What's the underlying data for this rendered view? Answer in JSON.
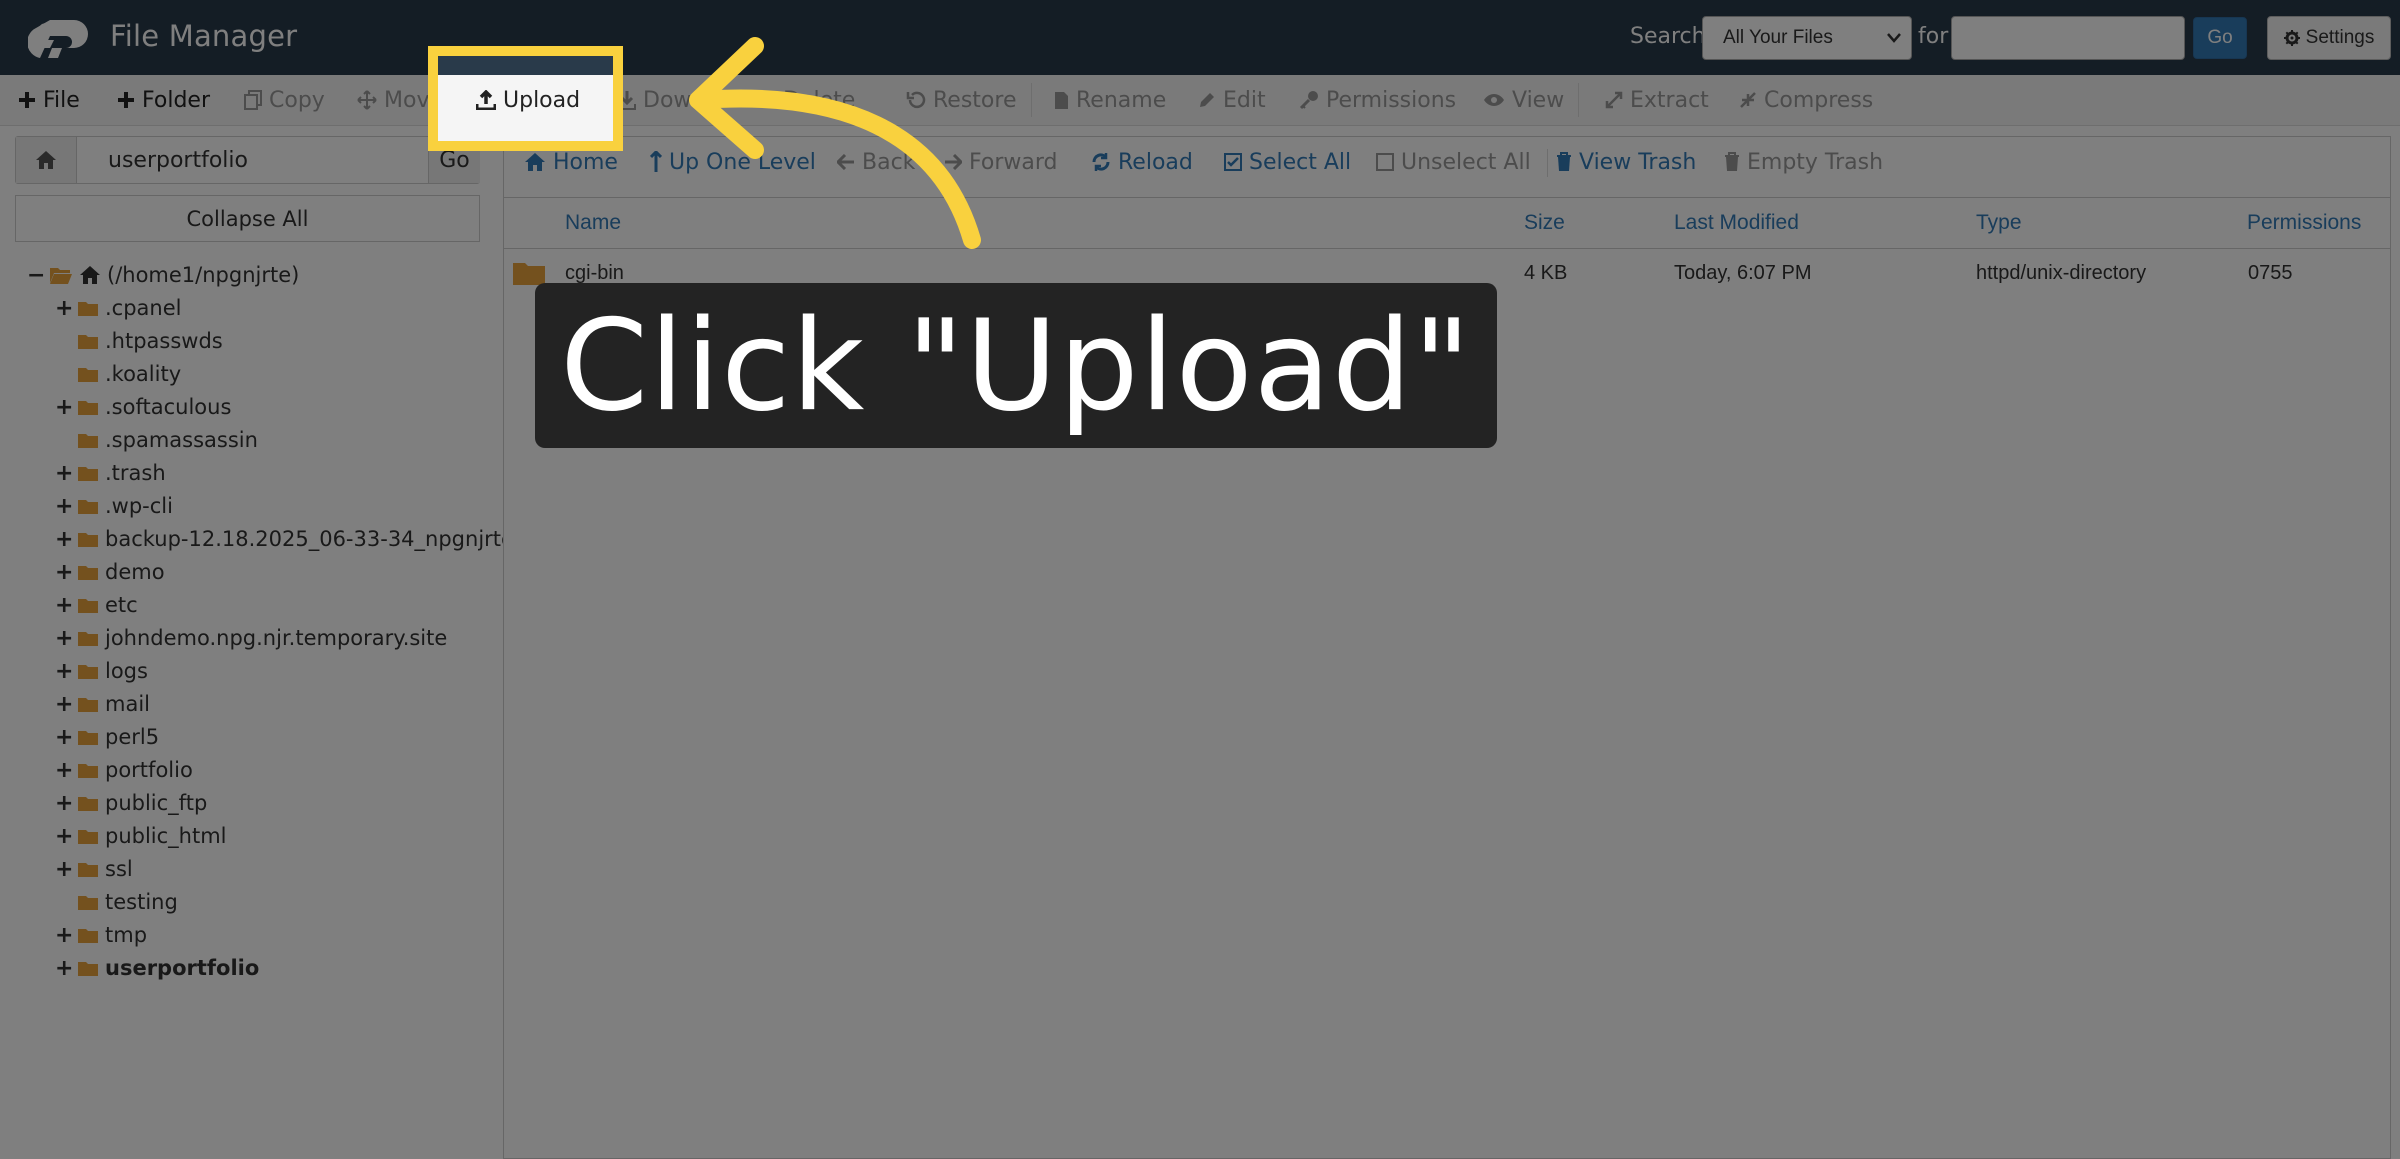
{
  "app": {
    "title": "File Manager"
  },
  "header": {
    "search_label": "Search",
    "search_scope": "All Your Files",
    "for_label": "for",
    "search_value": "",
    "go_label": "Go",
    "settings_label": "Settings"
  },
  "toolbar": {
    "file": "File",
    "folder": "Folder",
    "copy": "Copy",
    "move": "Move",
    "upload": "Upload",
    "download": "Download",
    "delete": "Delete",
    "restore": "Restore",
    "rename": "Rename",
    "edit": "Edit",
    "permissions": "Permissions",
    "view": "View",
    "extract": "Extract",
    "compress": "Compress"
  },
  "sidebar": {
    "path_value": "userportfolio",
    "go_label": "Go",
    "collapse_label": "Collapse All",
    "root_label": "(/home1/npgnjrte)",
    "tree": [
      {
        "label": ".cpanel",
        "expandable": true,
        "bold": false
      },
      {
        "label": ".htpasswds",
        "expandable": false,
        "bold": false
      },
      {
        "label": ".koality",
        "expandable": false,
        "bold": false
      },
      {
        "label": ".softaculous",
        "expandable": true,
        "bold": false
      },
      {
        "label": ".spamassassin",
        "expandable": false,
        "bold": false
      },
      {
        "label": ".trash",
        "expandable": true,
        "bold": false
      },
      {
        "label": ".wp-cli",
        "expandable": true,
        "bold": false
      },
      {
        "label": "backup-12.18.2025_06-33-34_npgnjrte",
        "expandable": true,
        "bold": false
      },
      {
        "label": "demo",
        "expandable": true,
        "bold": false
      },
      {
        "label": "etc",
        "expandable": true,
        "bold": false
      },
      {
        "label": "johndemo.npg.njr.temporary.site",
        "expandable": true,
        "bold": false
      },
      {
        "label": "logs",
        "expandable": true,
        "bold": false
      },
      {
        "label": "mail",
        "expandable": true,
        "bold": false
      },
      {
        "label": "perl5",
        "expandable": true,
        "bold": false
      },
      {
        "label": "portfolio",
        "expandable": true,
        "bold": false
      },
      {
        "label": "public_ftp",
        "expandable": true,
        "bold": false
      },
      {
        "label": "public_html",
        "expandable": true,
        "bold": false
      },
      {
        "label": "ssl",
        "expandable": true,
        "bold": false
      },
      {
        "label": "testing",
        "expandable": false,
        "bold": false
      },
      {
        "label": "tmp",
        "expandable": true,
        "bold": false
      },
      {
        "label": "userportfolio",
        "expandable": true,
        "bold": true
      }
    ]
  },
  "nav": {
    "home": "Home",
    "up_one_level": "Up One Level",
    "back": "Back",
    "forward": "Forward",
    "reload": "Reload",
    "select_all": "Select All",
    "unselect_all": "Unselect All",
    "view_trash": "View Trash",
    "empty_trash": "Empty Trash"
  },
  "table": {
    "columns": [
      "Name",
      "Size",
      "Last Modified",
      "Type",
      "Permissions"
    ],
    "rows": [
      {
        "name": "cgi-bin",
        "size": "4 KB",
        "modified": "Today, 6:07 PM",
        "type": "httpd/unix-directory",
        "perms": "0755"
      }
    ]
  },
  "annotation": {
    "caption": "Click \"Upload\"",
    "highlight_color": "#f9d13e"
  },
  "colors": {
    "header_bg": "#293a4a",
    "link_blue": "#337ab7",
    "folder": "#e8a33d",
    "overlay": "rgba(0,0,0,0.5)"
  }
}
